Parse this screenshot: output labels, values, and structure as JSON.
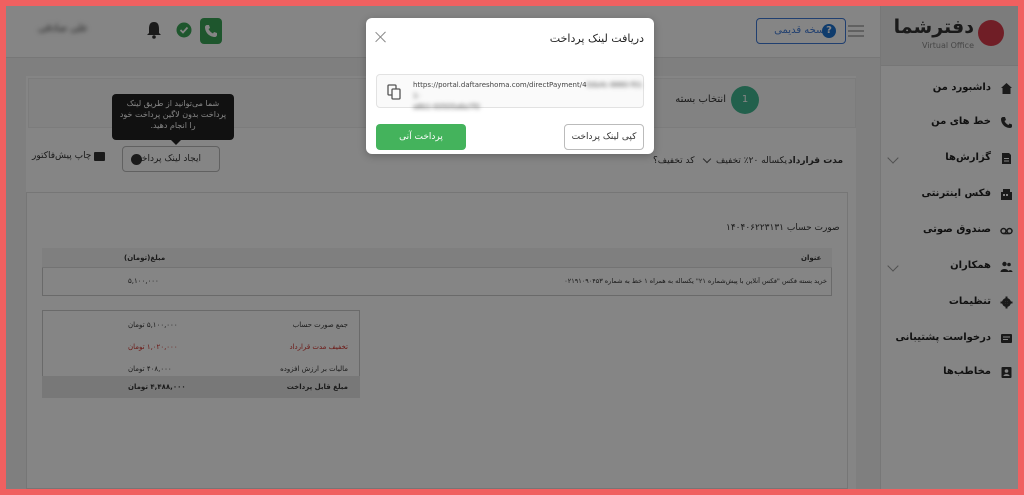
{
  "topbar": {
    "user_name": "علی صادقی",
    "old_version_label": "نسخه قدیمی",
    "help_glyph": "?"
  },
  "sidebar": {
    "logo_text": "دفترشما",
    "logo_sub": "Virtual Office",
    "items": [
      {
        "label": "داشبورد من",
        "icon": "home-icon"
      },
      {
        "label": "خط های من",
        "icon": "phone-icon"
      },
      {
        "label": "گزارش‌ها",
        "icon": "report-icon"
      },
      {
        "label": "فکس اینترنتی",
        "icon": "fax-icon"
      },
      {
        "label": "صندوق صوتی",
        "icon": "voicemail-icon"
      },
      {
        "label": "همکاران",
        "icon": "users-icon"
      },
      {
        "label": "تنظیمات",
        "icon": "gear-icon"
      },
      {
        "label": "درخواست پشتیبانی",
        "icon": "support-icon"
      },
      {
        "label": "مخاطب‌ها",
        "icon": "contacts-icon"
      }
    ]
  },
  "steps": {
    "current_number": "1",
    "current_label": "انتخاب بسته"
  },
  "toolbar": {
    "tooltip": "شما می‌توانید از طریق لینک پرداخت بدون لاگین پرداخت خود را انجام دهید.",
    "create_link_label": "ایجاد لینک پرداخت",
    "print_label": "چاپ پیش‌فاکتور",
    "contract_label": "مدت قرارداد",
    "contract_value": "یکساله ۲۰٪ تخفیف",
    "discount_label": "کد تخفیف؟"
  },
  "invoice": {
    "title": "صورت حساب ۱۴۰۴۰۶۲۲۳۱۳۱",
    "col_title": "عنوان",
    "col_amount": "مبلغ(تومان)",
    "item_desc": "خرید بسته فکس \"فکس آنلاین با پیش‌شماره ۲۱\" یکساله به همراه ۱ خط به شماره ۰۲۱۹۱۰۹۰۴۵۳",
    "item_amount": "۵,۱۰۰,۰۰۰",
    "summary": [
      {
        "key": "جمع صورت حساب",
        "value": "۵,۱۰۰,۰۰۰ تومان",
        "color": "#333333"
      },
      {
        "key": "تخفیف مدت قرارداد",
        "value": "۱,۰۲۰,۰۰۰ تومان",
        "color": "#d0302a"
      },
      {
        "key": "مالیات بر ارزش افزوده",
        "value": "۴۰۸,۰۰۰ تومان",
        "color": "#333333"
      },
      {
        "key": "مبلغ قابل پرداخت",
        "value": "۴,۴۸۸,۰۰۰ تومان",
        "color": "#333333"
      }
    ]
  },
  "modal": {
    "title": "دریافت لینک پرداخت",
    "link_visible": "https://portal.daftareshoma.com/directPayment/4",
    "link_hidden_1": "0da4c-8860-f011-",
    "link_hidden_2": "a8b1-00505a6a7f0",
    "copy_label": "کپی لینک پرداخت",
    "pay_label": "پرداخت آنی"
  },
  "colors": {
    "accent_green": "#44b35c",
    "accent_blue": "#3f7ad6",
    "step_teal": "#42b892",
    "outer_frame": "#f06060"
  }
}
